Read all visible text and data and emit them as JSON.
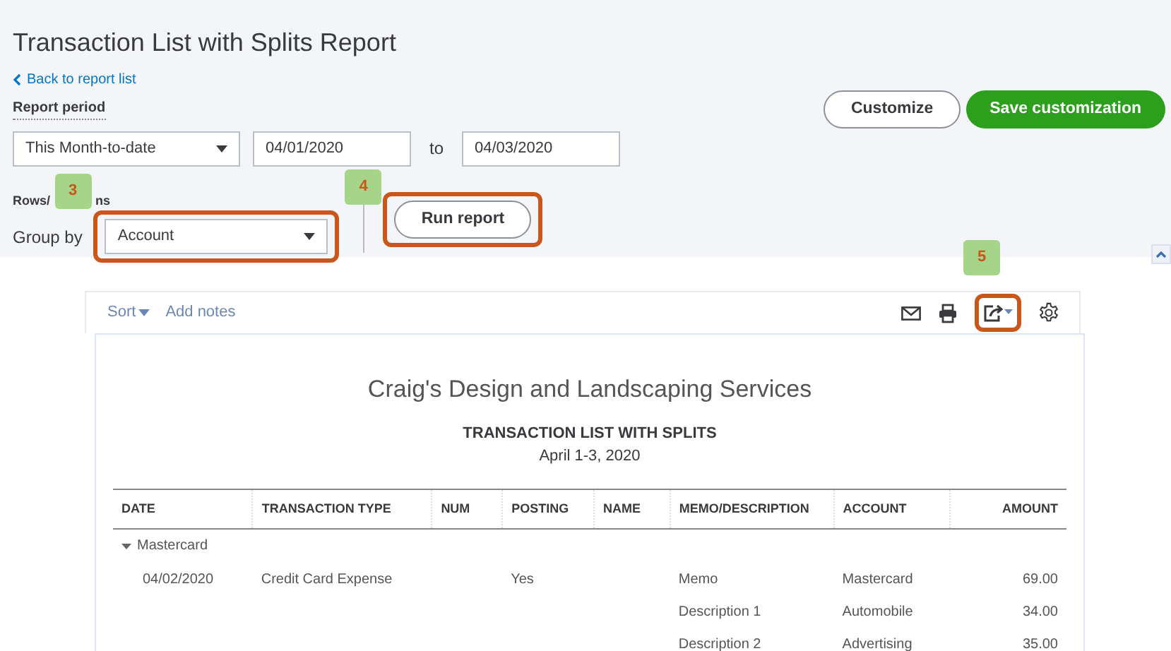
{
  "header": {
    "title": "Transaction List with Splits Report",
    "back_link": "Back to report list",
    "report_period_label": "Report period",
    "period_select": "This Month-to-date",
    "date_from": "04/01/2020",
    "to_label": "to",
    "date_to": "04/03/2020",
    "rows_columns_label_parts": [
      "Rows/",
      "ns"
    ],
    "group_by_label": "Group by",
    "group_by_select": "Account",
    "run_button": "Run report",
    "customize_button": "Customize",
    "save_button": "Save customization"
  },
  "annotations": [
    {
      "number": "3"
    },
    {
      "number": "4"
    },
    {
      "number": "5"
    }
  ],
  "toolbar": {
    "sort": "Sort",
    "add_notes": "Add notes"
  },
  "report": {
    "company": "Craig's Design and Landscaping Services",
    "title": "TRANSACTION LIST WITH SPLITS",
    "subtitle": "April 1-3, 2020",
    "columns": [
      "DATE",
      "TRANSACTION TYPE",
      "NUM",
      "POSTING",
      "NAME",
      "MEMO/DESCRIPTION",
      "ACCOUNT",
      "AMOUNT"
    ],
    "groups": [
      {
        "name": "Mastercard",
        "expanded": true,
        "rows": [
          [
            "04/02/2020",
            "Credit Card Expense",
            "",
            "Yes",
            "",
            "Memo",
            "Mastercard",
            "69.00"
          ],
          [
            "",
            "",
            "",
            "",
            "",
            "Description 1",
            "Automobile",
            "34.00"
          ],
          [
            "",
            "",
            "",
            "",
            "",
            "Description 2",
            "Advertising",
            "35.00"
          ]
        ]
      }
    ]
  }
}
